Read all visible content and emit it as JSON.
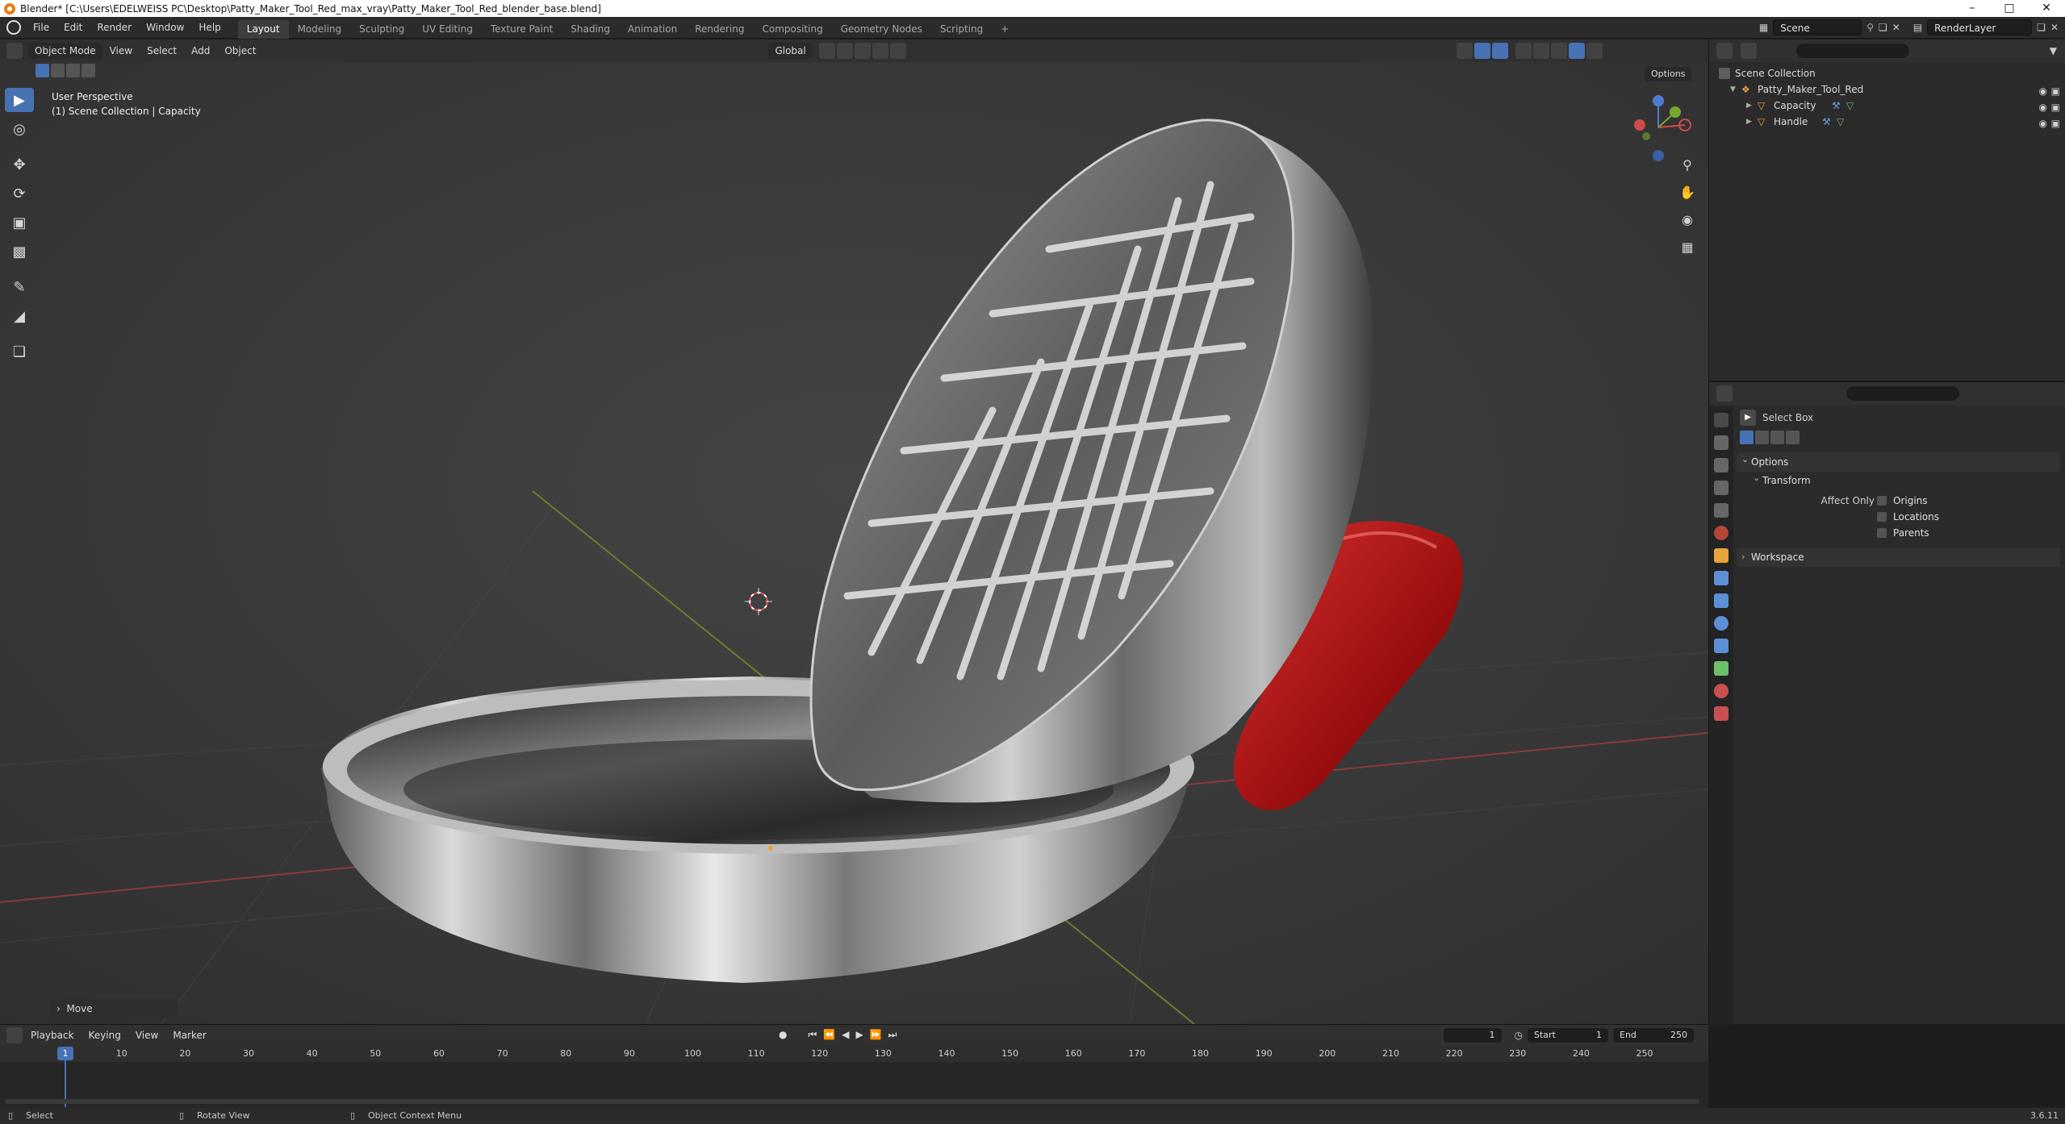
{
  "window": {
    "title": "Blender* [C:\\Users\\EDELWEISS PC\\Desktop\\Patty_Maker_Tool_Red_max_vray\\Patty_Maker_Tool_Red_blender_base.blend]",
    "minimize": "–",
    "maximize": "□",
    "close": "✕"
  },
  "menu": {
    "file": "File",
    "edit": "Edit",
    "render": "Render",
    "window": "Window",
    "help": "Help"
  },
  "workspaces": [
    "Layout",
    "Modeling",
    "Sculpting",
    "UV Editing",
    "Texture Paint",
    "Shading",
    "Animation",
    "Rendering",
    "Compositing",
    "Geometry Nodes",
    "Scripting"
  ],
  "active_workspace": "Layout",
  "add_workspace": "+",
  "scene": {
    "name": "Scene",
    "view_layer": "RenderLayer"
  },
  "viewport": {
    "mode": "Object Mode",
    "view": "View",
    "select": "Select",
    "add": "Add",
    "object": "Object",
    "transform_orientation": "Global",
    "options": "Options",
    "perspective_label": "User Perspective",
    "collection_label": "(1) Scene Collection | Capacity",
    "last_operator": "Move",
    "colors": {
      "accent": "#4772b3",
      "metal": "#b9b9b9",
      "handle_red": "#b01616"
    }
  },
  "outliner": {
    "root": "Scene Collection",
    "items": [
      {
        "name": "Patty_Maker_Tool_Red",
        "level": 1
      },
      {
        "name": "Capacity",
        "level": 2
      },
      {
        "name": "Handle",
        "level": 2
      }
    ]
  },
  "properties": {
    "active_tool": "Select Box",
    "options_panel": "Options",
    "transform_sub": "Transform",
    "affect_only_label": "Affect Only",
    "checkboxes": [
      "Origins",
      "Locations",
      "Parents"
    ],
    "workspace_panel": "Workspace"
  },
  "timeline": {
    "playback": "Playback",
    "keying": "Keying",
    "view": "View",
    "marker": "Marker",
    "current_frame": "1",
    "start_label": "Start",
    "start": "1",
    "end_label": "End",
    "end": "250",
    "ticks": [
      "1",
      "10",
      "20",
      "30",
      "40",
      "50",
      "60",
      "70",
      "80",
      "90",
      "100",
      "110",
      "120",
      "130",
      "140",
      "150",
      "160",
      "170",
      "180",
      "190",
      "200",
      "210",
      "220",
      "230",
      "240",
      "250"
    ]
  },
  "statusbar": {
    "select": "Select",
    "rotate": "Rotate View",
    "context": "Object Context Menu",
    "version": "3.6.11"
  }
}
